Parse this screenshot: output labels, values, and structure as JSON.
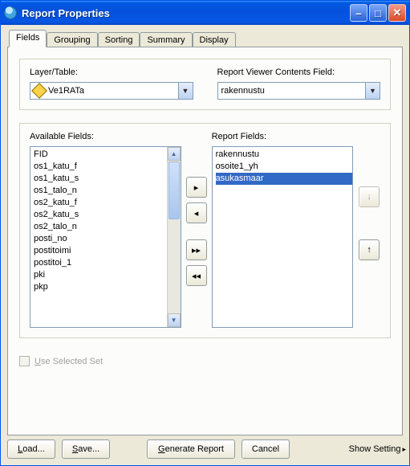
{
  "window": {
    "title": "Report Properties"
  },
  "tabs": [
    "Fields",
    "Grouping",
    "Sorting",
    "Summary",
    "Display"
  ],
  "layerTable": {
    "label": "Layer/Table:",
    "value": "Ve1RATa"
  },
  "viewerField": {
    "label": "Report Viewer Contents Field:",
    "value": "rakennustu"
  },
  "available": {
    "label": "Available Fields:",
    "items": [
      "FID",
      "os1_katu_f",
      "os1_katu_s",
      "os1_talo_n",
      "os2_katu_f",
      "os2_katu_s",
      "os2_talo_n",
      "posti_no",
      "postitoimi",
      "postitoi_1",
      "pki",
      "pkp"
    ]
  },
  "report": {
    "label": "Report Fields:",
    "items": [
      "rakennustu",
      "osoite1_yh",
      "asukasmaar"
    ],
    "selectedIndex": 2
  },
  "useSelected": {
    "label": "Use Selected Set"
  },
  "buttons": {
    "load": "Load...",
    "save": "Save...",
    "generate": "Generate Report",
    "cancel": "Cancel",
    "showSettings": "Show Settings"
  }
}
